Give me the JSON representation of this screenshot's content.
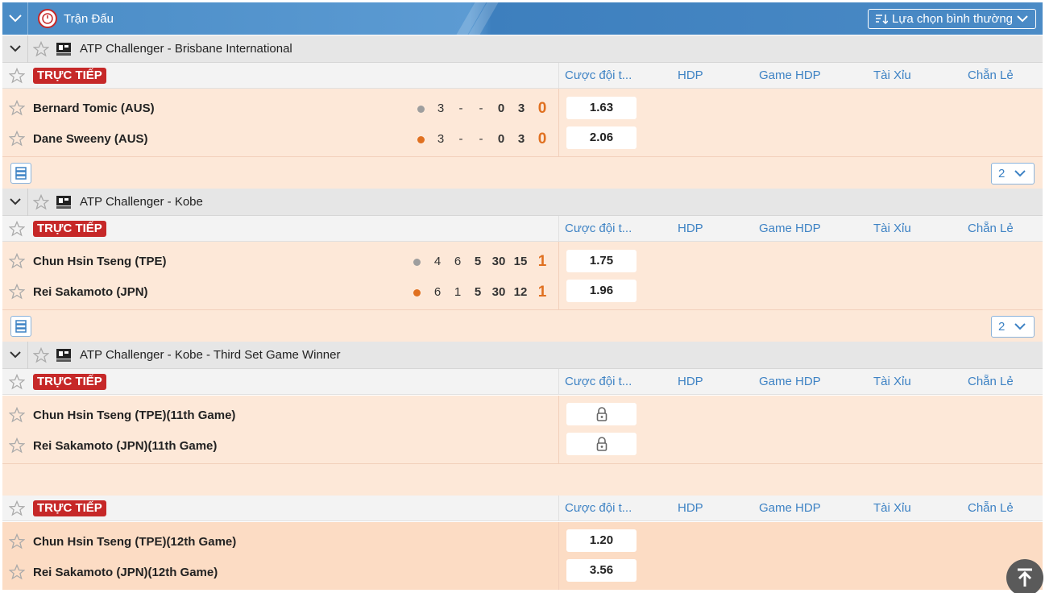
{
  "header": {
    "title": "Trận Đấu",
    "select_label": "Lựa chọn bình thường"
  },
  "columns": [
    "Cược đội t...",
    "HDP",
    "Game HDP",
    "Tài Xỉu",
    "Chẵn Lẻ"
  ],
  "live_label": "TRỰC TIẾP",
  "leagues": [
    {
      "name": "ATP Challenger - Brisbane International",
      "teams": [
        {
          "name": "Bernard Tomic (AUS)",
          "serving": false,
          "scores": [
            "3",
            "-",
            "-",
            "0",
            "3"
          ],
          "points": "0",
          "odds": "1.63"
        },
        {
          "name": "Dane Sweeny (AUS)",
          "serving": true,
          "scores": [
            "3",
            "-",
            "-",
            "0",
            "3"
          ],
          "points": "0",
          "odds": "2.06"
        }
      ],
      "more_count": "2"
    },
    {
      "name": "ATP Challenger - Kobe",
      "teams": [
        {
          "name": "Chun Hsin Tseng (TPE)",
          "serving": false,
          "scores": [
            "4",
            "6",
            "5",
            "30",
            "15"
          ],
          "points": "1",
          "odds": "1.75"
        },
        {
          "name": "Rei Sakamoto (JPN)",
          "serving": true,
          "scores": [
            "6",
            "1",
            "5",
            "30",
            "12"
          ],
          "points": "1",
          "odds": "1.96"
        }
      ],
      "more_count": "2"
    },
    {
      "name": "ATP Challenger - Kobe - Third Set Game Winner",
      "markets": [
        {
          "teams": [
            {
              "name": "Chun Hsin Tseng (TPE)(11th Game)",
              "odds": "locked"
            },
            {
              "name": "Rei Sakamoto (JPN)(11th Game)",
              "odds": "locked"
            }
          ]
        },
        {
          "teams": [
            {
              "name": "Chun Hsin Tseng (TPE)(12th Game)",
              "odds": "1.20"
            },
            {
              "name": "Rei Sakamoto (JPN)(12th Game)",
              "odds": "3.56"
            }
          ]
        }
      ]
    }
  ],
  "colors": {
    "accent": "#4a8cc6",
    "live_badge": "#c62828",
    "row_bg": "#fde8d8",
    "points": "#e07020",
    "serve_dot": "#e07020",
    "idle_dot": "#9e9e9e"
  }
}
